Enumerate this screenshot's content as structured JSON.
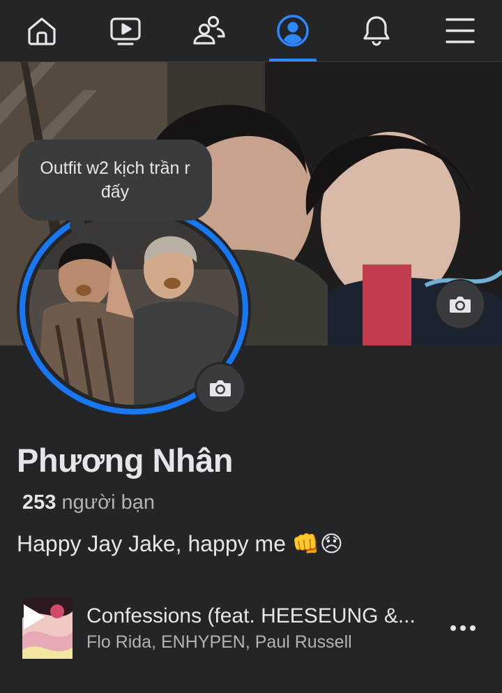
{
  "nav": {
    "items": [
      {
        "name": "home-icon"
      },
      {
        "name": "video-icon"
      },
      {
        "name": "friends-icon"
      },
      {
        "name": "profile-icon",
        "active": true
      },
      {
        "name": "bell-icon"
      },
      {
        "name": "menu-icon"
      }
    ],
    "active_color": "#2d88ff"
  },
  "note": {
    "text": "Outfit w2 kịch trần r đấy"
  },
  "profile": {
    "name": "Phương Nhân",
    "friends_count": "253",
    "friends_label": "người bạn",
    "bio": "Happy Jay Jake, happy me 👊😞"
  },
  "music": {
    "title": "Confessions (feat. HEESEUNG &...",
    "artists": "Flo Rida, ENHYPEN, Paul Russell"
  },
  "colors": {
    "background": "#242526",
    "accent": "#1877f2",
    "text": "#e4e6eb",
    "secondary_text": "#b0b3b8"
  }
}
